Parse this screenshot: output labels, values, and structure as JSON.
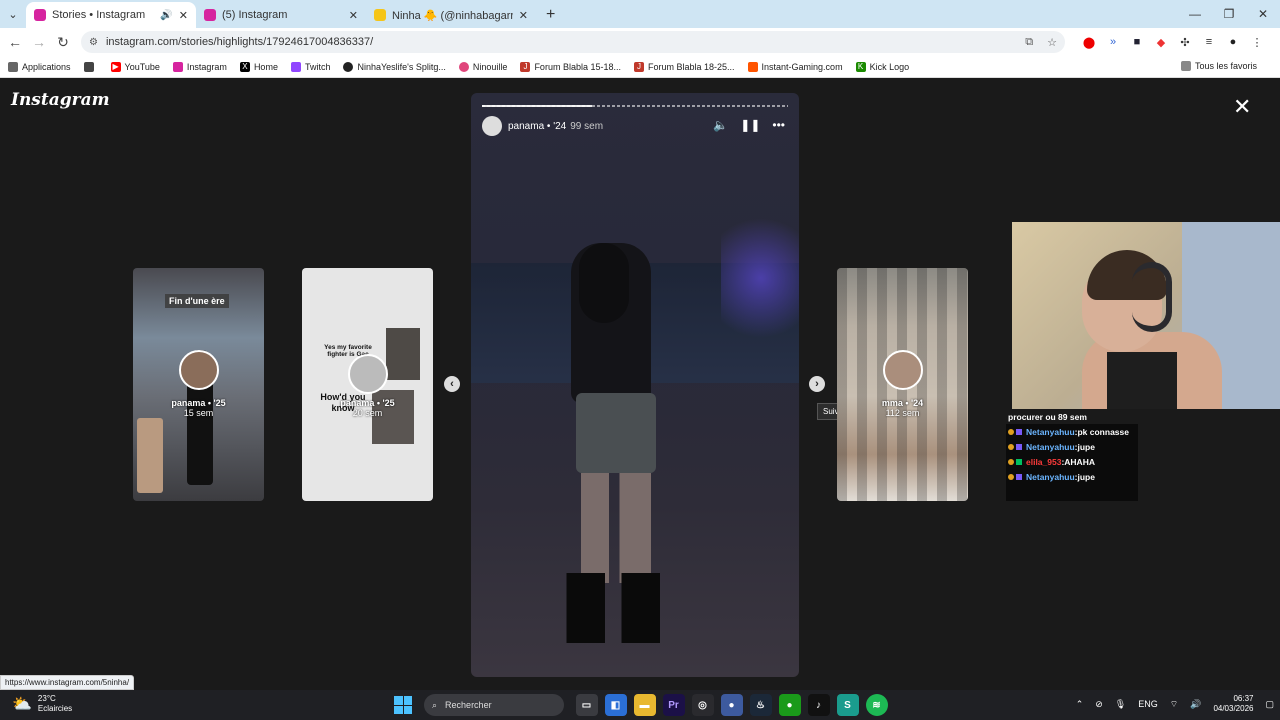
{
  "tabs": [
    {
      "title": "Stories • Instagram",
      "favicon_color": "#d6249f",
      "active": true
    },
    {
      "title": "(5) Instagram",
      "favicon_color": "#d6249f",
      "active": false
    },
    {
      "title": "Ninha 🐥 (@ninhabagarre) | Sh",
      "favicon_color": "#f5c518",
      "active": false
    }
  ],
  "address": {
    "url": "instagram.com/stories/highlights/17924617004836337/"
  },
  "bookmarks": [
    {
      "label": "Applications",
      "icon": "grid-icon",
      "color": "#555"
    },
    {
      "label": "YouTube",
      "icon": "youtube-icon",
      "color": "#ff0000"
    },
    {
      "label": "Instagram",
      "icon": "instagram-icon",
      "color": "#d6249f"
    },
    {
      "label": "Home",
      "icon": "x-icon",
      "color": "#000000"
    },
    {
      "label": "Twitch",
      "icon": "twitch-icon",
      "color": "#9146ff"
    },
    {
      "label": "NinhaYeslife's Splitg...",
      "icon": "circle-icon",
      "color": "#222222"
    },
    {
      "label": "Ninouille",
      "icon": "pink-icon",
      "color": "#e0457b"
    },
    {
      "label": "Forum Blabla 15-18...",
      "icon": "jvc-icon",
      "color": "#c0392b"
    },
    {
      "label": "Forum Blabla 18-25...",
      "icon": "jvc-icon",
      "color": "#c0392b"
    },
    {
      "label": "Instant-Gaming.com",
      "icon": "instant-gaming-icon",
      "color": "#ff5400"
    },
    {
      "label": "Kick Logo",
      "icon": "kick-icon",
      "color": "#53fc18"
    }
  ],
  "bookmarks_all": "Tous les favoris",
  "instagram": {
    "logo": "Instagram"
  },
  "story": {
    "user": "panama • '24",
    "time": "99 sem",
    "progress": 0.36
  },
  "left_cards": [
    {
      "caption": "Fin d'une ère",
      "user": "panama • '25",
      "time": "15 sem"
    },
    {
      "caption1": "Yes my favorite fighter is Gae",
      "caption2": "How'd you know",
      "user": "panama • '25",
      "time": "20 sem"
    }
  ],
  "right_card": {
    "user": "mma • '24",
    "time": "112 sem"
  },
  "tooltip": "Suivant",
  "chat": {
    "header": "procurer ou 89 sem",
    "messages": [
      {
        "user": "Netanyahuu",
        "text": ":pk connasse",
        "color": "#6bb5ff"
      },
      {
        "user": "Netanyahuu",
        "text": ":jupe",
        "color": "#6bb5ff"
      },
      {
        "user": "elila_953",
        "text": ":AHAHA",
        "color": "#ff3b3b"
      },
      {
        "user": "Netanyahuu",
        "text": ":jupe",
        "color": "#6bb5ff"
      }
    ]
  },
  "status_url": "https://www.instagram.com/5ninha/",
  "taskbar": {
    "weather_temp": "23°C",
    "weather_desc": "Eclaircies",
    "search": "Rechercher",
    "lang": "ENG",
    "time": "06:37",
    "date": "04/03/2026"
  }
}
